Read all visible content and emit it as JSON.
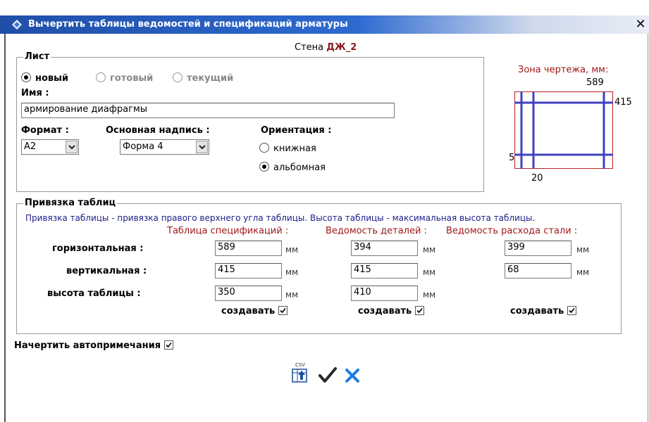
{
  "window": {
    "title": "Вычертить таблицы ведомостей и спецификаций арматуры",
    "close_glyph": "✕"
  },
  "wall": {
    "prefix": "Стена",
    "name": "ДЖ_2"
  },
  "sheet": {
    "legend": "Лист",
    "options": [
      {
        "label": "новый",
        "selected": true,
        "enabled": true
      },
      {
        "label": "готовый",
        "selected": false,
        "enabled": false
      },
      {
        "label": "текущий",
        "selected": false,
        "enabled": false
      }
    ],
    "name_label": "Имя :",
    "name_value": "армирование диафрагмы",
    "format_label": "Формат :",
    "format_value": "А2",
    "stamp_label": "Основная надпись :",
    "stamp_value": "Форма 4",
    "orientation_label": "Ориентация :",
    "orientation_options": [
      {
        "label": "книжная",
        "selected": false
      },
      {
        "label": "альбомная",
        "selected": true
      }
    ]
  },
  "drawing_zone": {
    "title": "Зона чертежа, мм:",
    "top": "589",
    "right": "415",
    "left": "5",
    "bottom": "20",
    "frame_color": "#c02020",
    "line_color": "#4040c0"
  },
  "binding": {
    "legend": "Привязка таблиц",
    "note": "Привязка таблицы - привязка правого верхнего угла таблицы. Высота таблицы - максимальная высота таблицы.",
    "columns": [
      "Таблица спецификаций :",
      "Ведомость деталей :",
      "Ведомость расхода стали :"
    ],
    "rows": [
      {
        "label": "горизонтальная :",
        "values": [
          "589",
          "394",
          "399"
        ]
      },
      {
        "label": "вертикальная :",
        "values": [
          "415",
          "415",
          "68"
        ]
      },
      {
        "label": "высота таблицы :",
        "values": [
          "350",
          "410",
          ""
        ]
      }
    ],
    "unit": "мм",
    "create_label": "создавать",
    "create_checked": [
      true,
      true,
      true
    ]
  },
  "auto_notes": {
    "label": "Начертить автопримечания",
    "checked": true
  },
  "toolbar": {
    "csv_label": "CSV",
    "ok_icon": "checkmark-icon",
    "cancel_icon": "cross-icon"
  }
}
